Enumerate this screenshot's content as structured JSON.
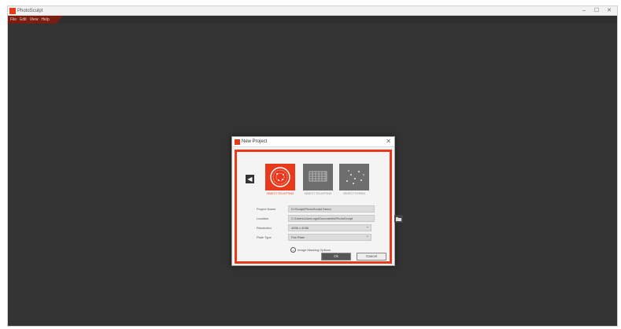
{
  "window": {
    "title": "PhotoSculpt",
    "controls": [
      "–",
      "☐",
      "✕"
    ],
    "menu": [
      "File",
      "Edit",
      "View",
      "Help"
    ]
  },
  "dialog": {
    "title": "New Project",
    "close": "✕",
    "back_icon": "arrow-left-icon",
    "project_types": [
      {
        "label": "OBJECT SCULPTING",
        "selected": true
      },
      {
        "label": "OBJECT SCULPTING",
        "selected": false
      },
      {
        "label": "OBJECT POSING",
        "selected": false
      }
    ],
    "fields": {
      "project_name": {
        "label": "Project Name",
        "value": "D:\\Sculpt\\PhotoSculpt Demo"
      },
      "location": {
        "label": "Location",
        "value": "C:\\Users\\UserLogo\\Documents\\PhotoSculpt"
      },
      "resolution": {
        "label": "Resolution",
        "value": "4096 x 4096"
      },
      "plate_type": {
        "label": "Plate Type",
        "value": "Flat Plate"
      }
    },
    "advanced_label": "Image Masking Options",
    "ok_label": "Ok",
    "cancel_label": "Cancel"
  },
  "colors": {
    "accent": "#e8391d",
    "backdrop": "#333333"
  }
}
